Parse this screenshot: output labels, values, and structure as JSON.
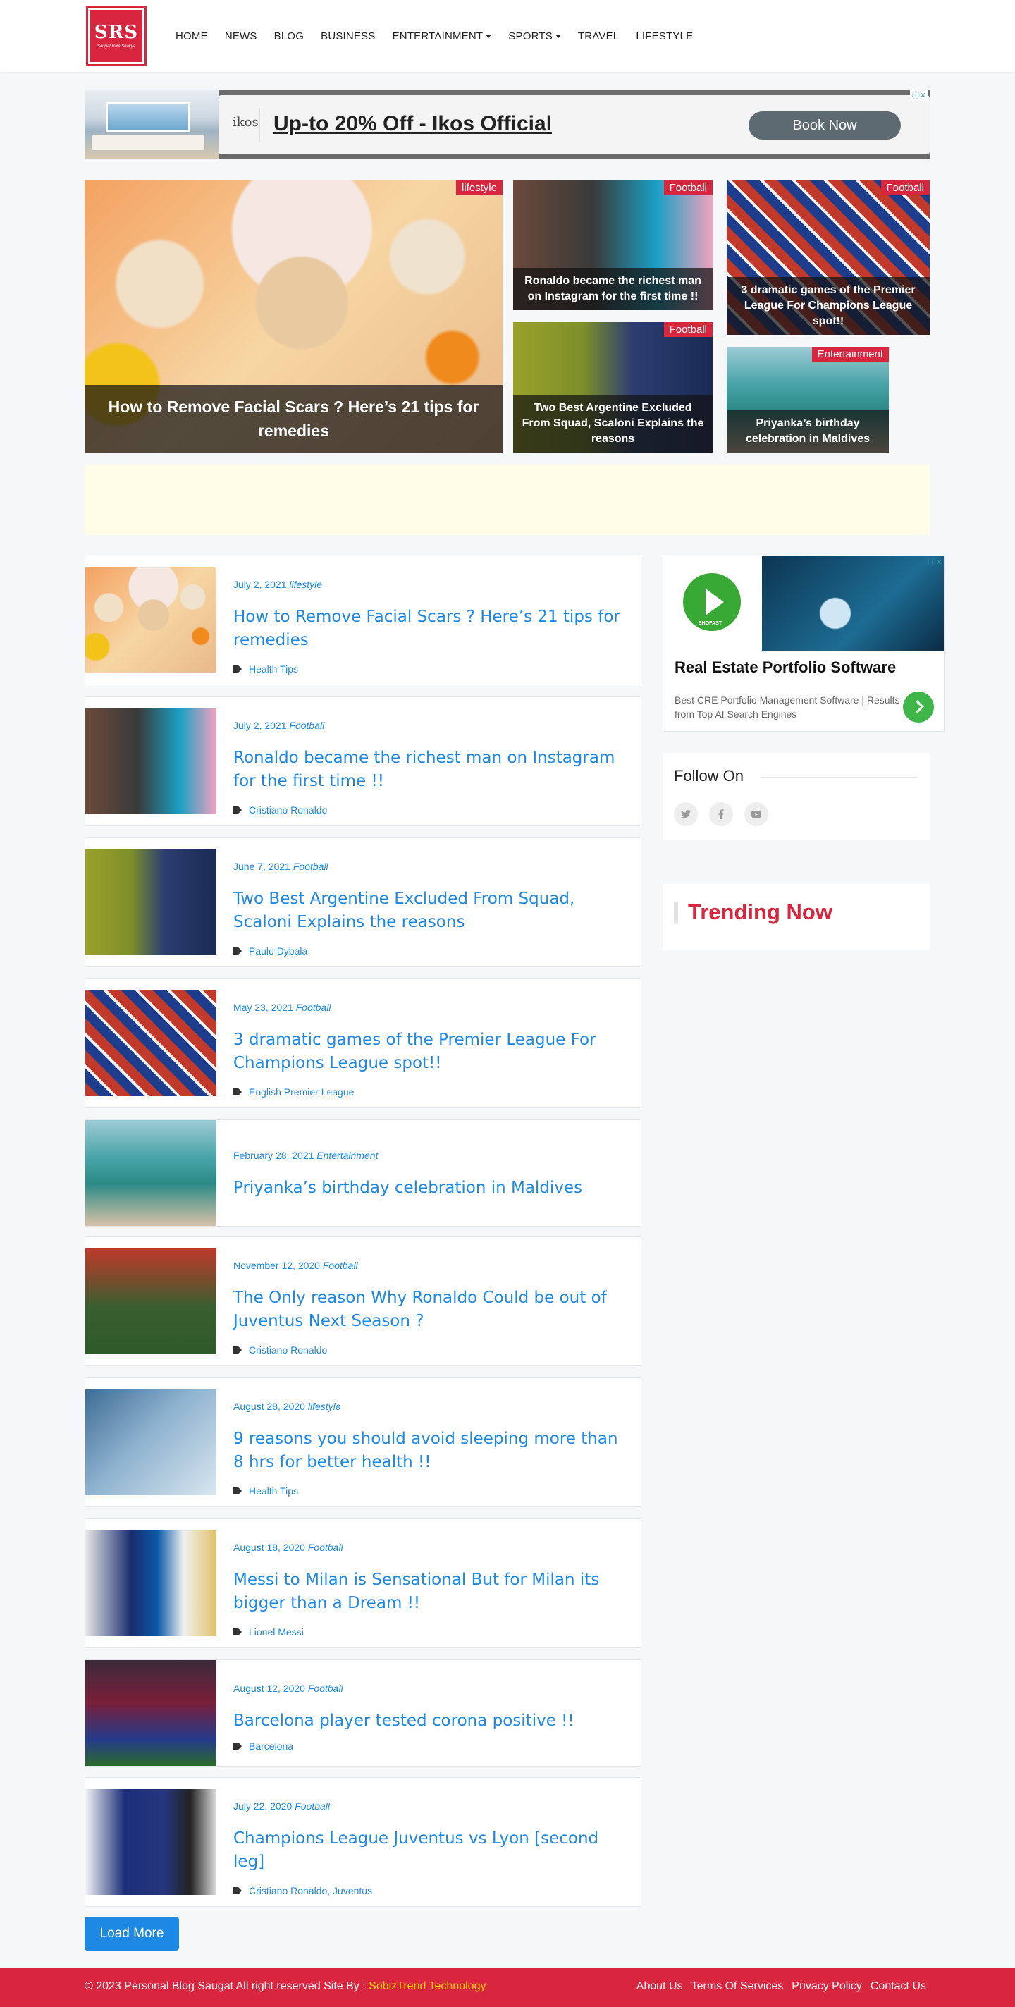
{
  "header": {
    "logo_text": "SRS",
    "logo_sub": "Saugat Ravi Shakya",
    "nav": [
      {
        "label": "HOME",
        "dropdown": false
      },
      {
        "label": "NEWS",
        "dropdown": false
      },
      {
        "label": "BLOG",
        "dropdown": false
      },
      {
        "label": "BUSINESS",
        "dropdown": false
      },
      {
        "label": "ENTERTAINMENT",
        "dropdown": true
      },
      {
        "label": "SPORTS",
        "dropdown": true
      },
      {
        "label": "TRAVEL",
        "dropdown": false
      },
      {
        "label": "LIFESTYLE",
        "dropdown": false
      }
    ]
  },
  "top_ad": {
    "brand": "ikos",
    "title": "Up-to 20% Off - Ikos Official",
    "button": "Book Now",
    "close": "ⓘ✕"
  },
  "featured": {
    "main": {
      "category": "lifestyle",
      "title": "How to Remove Facial Scars ? Here’s 21 tips for remedies"
    },
    "tiles": [
      {
        "category": "Football",
        "title": "Ronaldo became the richest man on Instagram for the first time !!"
      },
      {
        "category": "Football",
        "title": "3 dramatic games of the Premier League For Champions League spot!!"
      },
      {
        "category": "Football",
        "title": "Two Best Argentine Excluded From Squad, Scaloni Explains the reasons"
      },
      {
        "category": "Entertainment",
        "title": "Priyanka’s birthday celebration in Maldives"
      }
    ]
  },
  "posts": [
    {
      "date": "July 2, 2021",
      "category": "lifestyle",
      "title": "How to Remove Facial Scars ? Here’s 21 tips for remedies",
      "tags": "Health Tips"
    },
    {
      "date": "July 2, 2021",
      "category": "Football",
      "title": "Ronaldo became the richest man on Instagram for the first time !!",
      "tags": "Cristiano Ronaldo"
    },
    {
      "date": "June 7, 2021",
      "category": "Football",
      "title": "Two Best Argentine Excluded From Squad, Scaloni Explains the reasons",
      "tags": "Paulo Dybala"
    },
    {
      "date": "May 23, 2021",
      "category": "Football",
      "title": "3 dramatic games of the Premier League For Champions League spot!!",
      "tags": "English Premier League"
    },
    {
      "date": "February 28, 2021",
      "category": "Entertainment",
      "title": "Priyanka’s birthday celebration in Maldives",
      "tags": ""
    },
    {
      "date": "November 12, 2020",
      "category": "Football",
      "title": "The Only reason Why Ronaldo Could be out of Juventus Next Season ?",
      "tags": "Cristiano Ronaldo"
    },
    {
      "date": "August 28, 2020",
      "category": "lifestyle",
      "title": "9 reasons you should avoid sleeping more than 8 hrs for better health !!",
      "tags": "Health Tips"
    },
    {
      "date": "August 18, 2020",
      "category": "Football",
      "title": "Messi to Milan is Sensational But for Milan its bigger than a Dream !!",
      "tags": "Lionel Messi"
    },
    {
      "date": "August 12, 2020",
      "category": "Football",
      "title": "Barcelona player tested corona positive !!",
      "tags": "Barcelona"
    },
    {
      "date": "July 22, 2020",
      "category": "Football",
      "title": "Champions League Juventus vs Lyon [second leg]",
      "tags": "Cristiano Ronaldo, Juventus"
    }
  ],
  "load_more": "Load More",
  "side_ad": {
    "brand": "SHOFAST",
    "title": "Real Estate Portfolio Software",
    "desc": "Best CRE Portfolio Management Software | Results from Top AI Search Engines"
  },
  "follow": {
    "title": "Follow On",
    "icons": [
      "twitter-icon",
      "facebook-icon",
      "youtube-icon"
    ]
  },
  "trending": {
    "title": "Trending Now"
  },
  "footer": {
    "copy": "© 2023 Personal Blog Saugat All right reserved Site By :",
    "copy_link": "SobizTrend Technology",
    "links": [
      "About Us",
      "Terms Of Services",
      "Privacy Policy",
      "Contact Us"
    ]
  },
  "colors": {
    "brand_red": "#d7263d",
    "link_blue": "#1e88e5"
  }
}
